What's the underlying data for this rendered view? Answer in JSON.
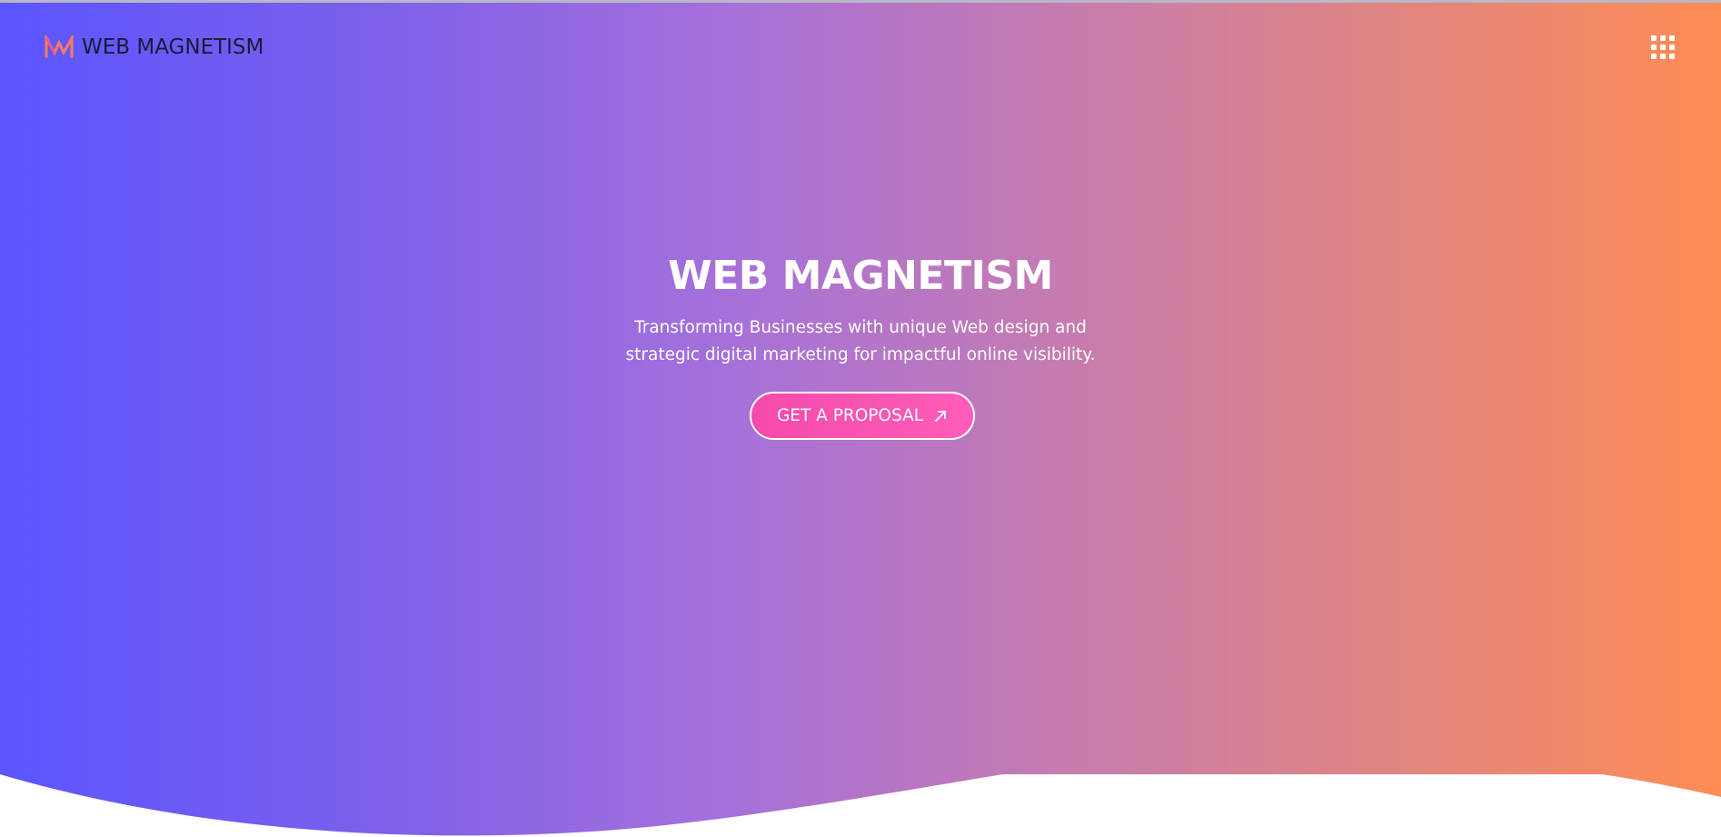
{
  "header": {
    "brand_name": "WEB MAGNETISM",
    "logo_icon": "web-magnetism-logo-icon",
    "menu_icon": "grid-menu-icon"
  },
  "hero": {
    "title": "WEB MAGNETISM",
    "subtitle": "Transforming Businesses with unique Web design and strategic digital marketing for impactful online visibility.",
    "cta_label": "GET A PROPOSAL",
    "cta_icon": "arrow-up-right-icon"
  },
  "colors": {
    "gradient_start": "#5b55ff",
    "gradient_middle": "#a670db",
    "gradient_end": "#ff8d55",
    "button_pink": "#f44aac",
    "logo_text": "#1b1b35",
    "logo_mark": "#ff7c5c",
    "white": "#ffffff"
  }
}
